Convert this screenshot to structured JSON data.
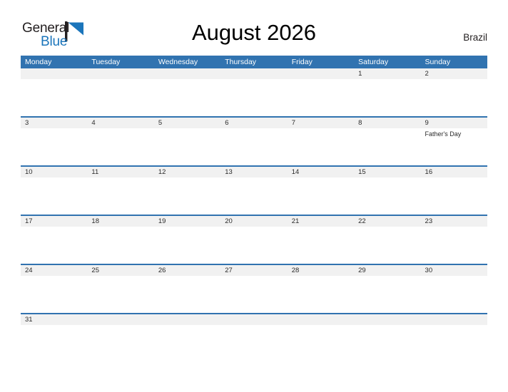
{
  "header": {
    "logo": {
      "word_one": "General",
      "word_two": "Blue",
      "flag_icon": "blue-flag-triangle-icon",
      "dark_color": "#231f20",
      "blue_color": "#1b75bb"
    },
    "title": "August 2026",
    "country": "Brazil"
  },
  "theme": {
    "header_blue": "#3173b0",
    "band_gray": "#f1f1f1",
    "separator_blue": "#3173b0",
    "text_dark": "#2b2b2b"
  },
  "calendar": {
    "month": "August",
    "year": "2026",
    "weekday_headers": [
      "Monday",
      "Tuesday",
      "Wednesday",
      "Thursday",
      "Friday",
      "Saturday",
      "Sunday"
    ],
    "weeks": [
      {
        "days": [
          {
            "num": "",
            "events": []
          },
          {
            "num": "",
            "events": []
          },
          {
            "num": "",
            "events": []
          },
          {
            "num": "",
            "events": []
          },
          {
            "num": "",
            "events": []
          },
          {
            "num": "1",
            "events": []
          },
          {
            "num": "2",
            "events": []
          }
        ]
      },
      {
        "days": [
          {
            "num": "3",
            "events": []
          },
          {
            "num": "4",
            "events": []
          },
          {
            "num": "5",
            "events": []
          },
          {
            "num": "6",
            "events": []
          },
          {
            "num": "7",
            "events": []
          },
          {
            "num": "8",
            "events": []
          },
          {
            "num": "9",
            "events": [
              "Father's Day"
            ]
          }
        ]
      },
      {
        "days": [
          {
            "num": "10",
            "events": []
          },
          {
            "num": "11",
            "events": []
          },
          {
            "num": "12",
            "events": []
          },
          {
            "num": "13",
            "events": []
          },
          {
            "num": "14",
            "events": []
          },
          {
            "num": "15",
            "events": []
          },
          {
            "num": "16",
            "events": []
          }
        ]
      },
      {
        "days": [
          {
            "num": "17",
            "events": []
          },
          {
            "num": "18",
            "events": []
          },
          {
            "num": "19",
            "events": []
          },
          {
            "num": "20",
            "events": []
          },
          {
            "num": "21",
            "events": []
          },
          {
            "num": "22",
            "events": []
          },
          {
            "num": "23",
            "events": []
          }
        ]
      },
      {
        "days": [
          {
            "num": "24",
            "events": []
          },
          {
            "num": "25",
            "events": []
          },
          {
            "num": "26",
            "events": []
          },
          {
            "num": "27",
            "events": []
          },
          {
            "num": "28",
            "events": []
          },
          {
            "num": "29",
            "events": []
          },
          {
            "num": "30",
            "events": []
          }
        ]
      },
      {
        "days": [
          {
            "num": "31",
            "events": []
          },
          {
            "num": "",
            "events": []
          },
          {
            "num": "",
            "events": []
          },
          {
            "num": "",
            "events": []
          },
          {
            "num": "",
            "events": []
          },
          {
            "num": "",
            "events": []
          },
          {
            "num": "",
            "events": []
          }
        ]
      }
    ]
  }
}
